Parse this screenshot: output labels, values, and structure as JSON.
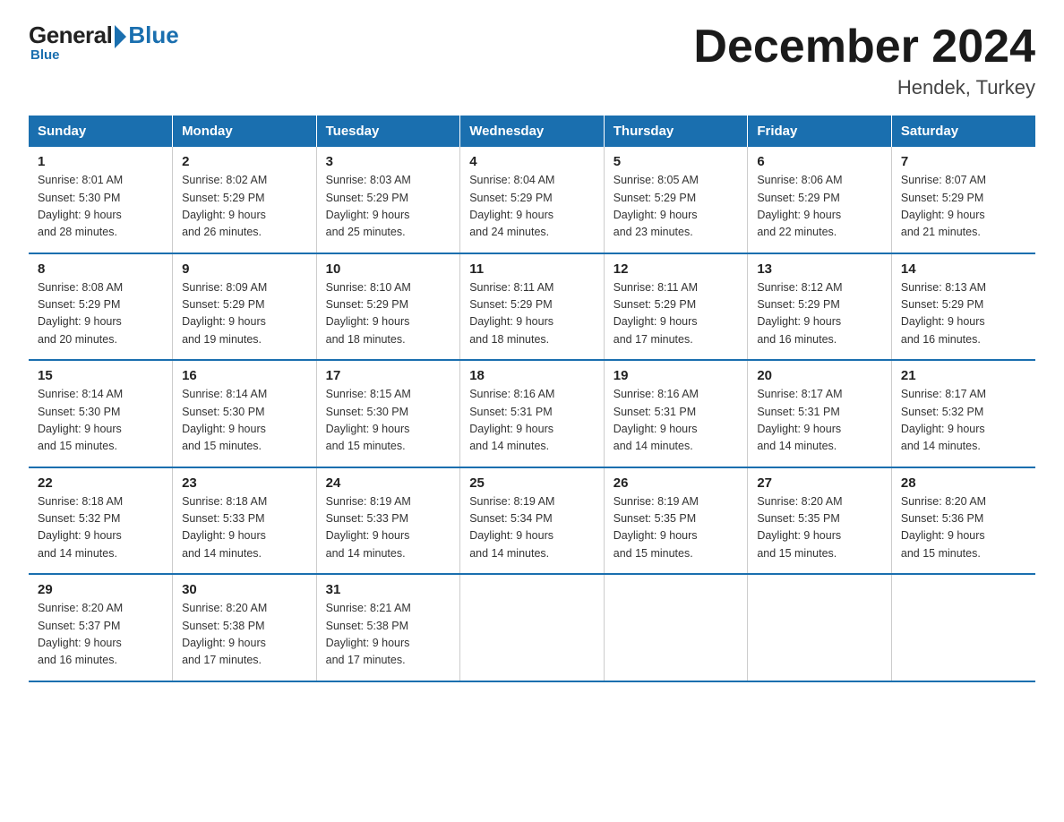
{
  "logo": {
    "general": "General",
    "blue": "Blue"
  },
  "title": "December 2024",
  "location": "Hendek, Turkey",
  "days_of_week": [
    "Sunday",
    "Monday",
    "Tuesday",
    "Wednesday",
    "Thursday",
    "Friday",
    "Saturday"
  ],
  "weeks": [
    [
      {
        "day": "1",
        "sunrise": "8:01 AM",
        "sunset": "5:30 PM",
        "daylight": "9 hours and 28 minutes."
      },
      {
        "day": "2",
        "sunrise": "8:02 AM",
        "sunset": "5:29 PM",
        "daylight": "9 hours and 26 minutes."
      },
      {
        "day": "3",
        "sunrise": "8:03 AM",
        "sunset": "5:29 PM",
        "daylight": "9 hours and 25 minutes."
      },
      {
        "day": "4",
        "sunrise": "8:04 AM",
        "sunset": "5:29 PM",
        "daylight": "9 hours and 24 minutes."
      },
      {
        "day": "5",
        "sunrise": "8:05 AM",
        "sunset": "5:29 PM",
        "daylight": "9 hours and 23 minutes."
      },
      {
        "day": "6",
        "sunrise": "8:06 AM",
        "sunset": "5:29 PM",
        "daylight": "9 hours and 22 minutes."
      },
      {
        "day": "7",
        "sunrise": "8:07 AM",
        "sunset": "5:29 PM",
        "daylight": "9 hours and 21 minutes."
      }
    ],
    [
      {
        "day": "8",
        "sunrise": "8:08 AM",
        "sunset": "5:29 PM",
        "daylight": "9 hours and 20 minutes."
      },
      {
        "day": "9",
        "sunrise": "8:09 AM",
        "sunset": "5:29 PM",
        "daylight": "9 hours and 19 minutes."
      },
      {
        "day": "10",
        "sunrise": "8:10 AM",
        "sunset": "5:29 PM",
        "daylight": "9 hours and 18 minutes."
      },
      {
        "day": "11",
        "sunrise": "8:11 AM",
        "sunset": "5:29 PM",
        "daylight": "9 hours and 18 minutes."
      },
      {
        "day": "12",
        "sunrise": "8:11 AM",
        "sunset": "5:29 PM",
        "daylight": "9 hours and 17 minutes."
      },
      {
        "day": "13",
        "sunrise": "8:12 AM",
        "sunset": "5:29 PM",
        "daylight": "9 hours and 16 minutes."
      },
      {
        "day": "14",
        "sunrise": "8:13 AM",
        "sunset": "5:29 PM",
        "daylight": "9 hours and 16 minutes."
      }
    ],
    [
      {
        "day": "15",
        "sunrise": "8:14 AM",
        "sunset": "5:30 PM",
        "daylight": "9 hours and 15 minutes."
      },
      {
        "day": "16",
        "sunrise": "8:14 AM",
        "sunset": "5:30 PM",
        "daylight": "9 hours and 15 minutes."
      },
      {
        "day": "17",
        "sunrise": "8:15 AM",
        "sunset": "5:30 PM",
        "daylight": "9 hours and 15 minutes."
      },
      {
        "day": "18",
        "sunrise": "8:16 AM",
        "sunset": "5:31 PM",
        "daylight": "9 hours and 14 minutes."
      },
      {
        "day": "19",
        "sunrise": "8:16 AM",
        "sunset": "5:31 PM",
        "daylight": "9 hours and 14 minutes."
      },
      {
        "day": "20",
        "sunrise": "8:17 AM",
        "sunset": "5:31 PM",
        "daylight": "9 hours and 14 minutes."
      },
      {
        "day": "21",
        "sunrise": "8:17 AM",
        "sunset": "5:32 PM",
        "daylight": "9 hours and 14 minutes."
      }
    ],
    [
      {
        "day": "22",
        "sunrise": "8:18 AM",
        "sunset": "5:32 PM",
        "daylight": "9 hours and 14 minutes."
      },
      {
        "day": "23",
        "sunrise": "8:18 AM",
        "sunset": "5:33 PM",
        "daylight": "9 hours and 14 minutes."
      },
      {
        "day": "24",
        "sunrise": "8:19 AM",
        "sunset": "5:33 PM",
        "daylight": "9 hours and 14 minutes."
      },
      {
        "day": "25",
        "sunrise": "8:19 AM",
        "sunset": "5:34 PM",
        "daylight": "9 hours and 14 minutes."
      },
      {
        "day": "26",
        "sunrise": "8:19 AM",
        "sunset": "5:35 PM",
        "daylight": "9 hours and 15 minutes."
      },
      {
        "day": "27",
        "sunrise": "8:20 AM",
        "sunset": "5:35 PM",
        "daylight": "9 hours and 15 minutes."
      },
      {
        "day": "28",
        "sunrise": "8:20 AM",
        "sunset": "5:36 PM",
        "daylight": "9 hours and 15 minutes."
      }
    ],
    [
      {
        "day": "29",
        "sunrise": "8:20 AM",
        "sunset": "5:37 PM",
        "daylight": "9 hours and 16 minutes."
      },
      {
        "day": "30",
        "sunrise": "8:20 AM",
        "sunset": "5:38 PM",
        "daylight": "9 hours and 17 minutes."
      },
      {
        "day": "31",
        "sunrise": "8:21 AM",
        "sunset": "5:38 PM",
        "daylight": "9 hours and 17 minutes."
      },
      null,
      null,
      null,
      null
    ]
  ],
  "labels": {
    "sunrise": "Sunrise:",
    "sunset": "Sunset:",
    "daylight": "Daylight:"
  }
}
